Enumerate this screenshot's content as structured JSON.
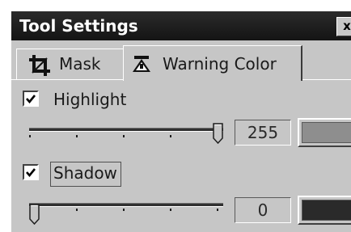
{
  "window": {
    "title": "Tool Settings",
    "close_glyph": "x"
  },
  "tabs": [
    {
      "label": "Mask",
      "icon": "crop-icon",
      "active": false
    },
    {
      "label": "Warning Color",
      "icon": "warning-color-icon",
      "active": true
    }
  ],
  "highlight": {
    "label": "Highlight",
    "checked": true,
    "value": "255",
    "slider_fraction": 1.0,
    "swatch_color": "#8e8e8e"
  },
  "shadow": {
    "label": "Shadow",
    "checked": true,
    "value": "0",
    "slider_fraction": 0.0,
    "swatch_color": "#2a2a2a"
  },
  "colors": {
    "panel": "#c6c6c6",
    "titlebar": "#1e1e1e",
    "title_text": "#ffffff"
  }
}
